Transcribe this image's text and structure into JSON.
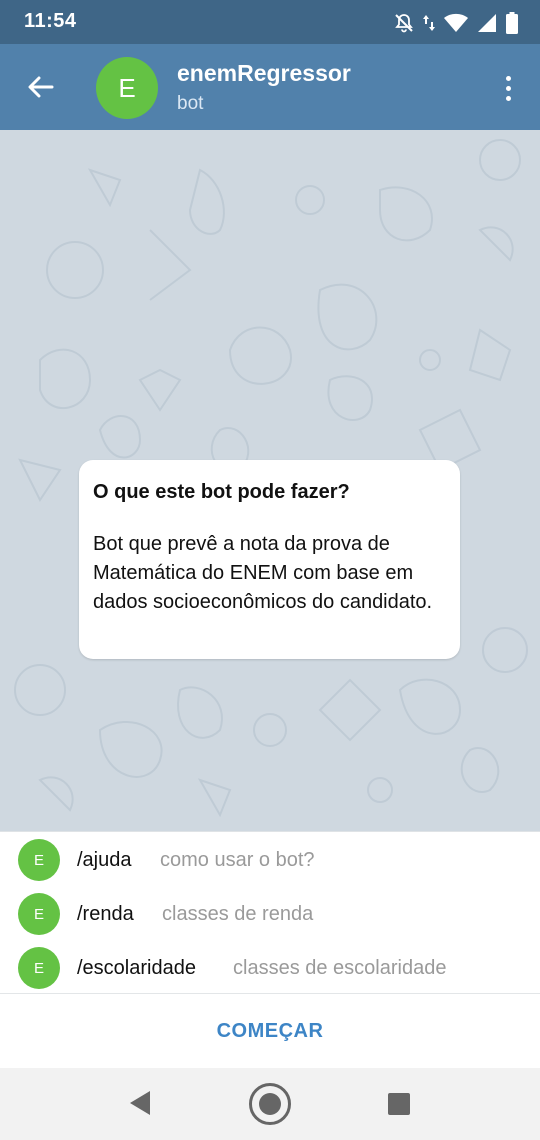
{
  "status_bar": {
    "time": "11:54",
    "icons": [
      "notifications-off-icon",
      "data-arrows-icon",
      "wifi-icon",
      "cell-signal-icon",
      "battery-icon"
    ]
  },
  "header": {
    "avatar_letter": "E",
    "title": "enemRegressor",
    "subtitle": "bot",
    "back_icon": "arrow-left-icon",
    "menu_icon": "more-vertical-icon"
  },
  "info_card": {
    "title": "O que este bot pode fazer?",
    "body": "Bot que prevê a nota da prova de Matemática do ENEM com base em dados socioeconômicos do candidato."
  },
  "commands": [
    {
      "avatar": "E",
      "command": "/ajuda",
      "description": "como usar o bot?"
    },
    {
      "avatar": "E",
      "command": "/renda",
      "description": "classes de renda"
    },
    {
      "avatar": "E",
      "command": "/escolaridade",
      "description": "classes de escolaridade"
    }
  ],
  "start_button": {
    "label": "COMEÇAR"
  },
  "colors": {
    "header": "#5181ab",
    "status_bar": "#3f6687",
    "avatar": "#64c244",
    "accent": "#3d85c6",
    "wallpaper": "#cfd8e0"
  }
}
